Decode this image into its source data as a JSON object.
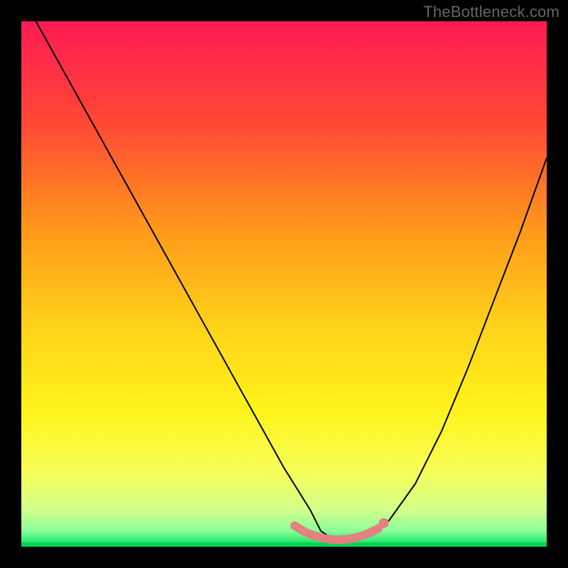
{
  "watermark": "TheBottleneck.com",
  "chart_data": {
    "type": "line",
    "title": "",
    "xlabel": "",
    "ylabel": "",
    "xlim": [
      0,
      100
    ],
    "ylim": [
      0,
      100
    ],
    "grid": false,
    "legend": false,
    "background_gradient": {
      "stops": [
        {
          "offset": 0.0,
          "color": "#ff1a53"
        },
        {
          "offset": 0.2,
          "color": "#ff4a33"
        },
        {
          "offset": 0.4,
          "color": "#ff9a1a"
        },
        {
          "offset": 0.58,
          "color": "#ffd21a"
        },
        {
          "offset": 0.74,
          "color": "#fff31a"
        },
        {
          "offset": 0.86,
          "color": "#f5ff5a"
        },
        {
          "offset": 0.93,
          "color": "#d2ff8a"
        },
        {
          "offset": 0.97,
          "color": "#8aff9a"
        },
        {
          "offset": 1.0,
          "color": "#00e05a"
        }
      ]
    },
    "series": [
      {
        "name": "bottleneck-curve",
        "color": "#000000",
        "x": [
          0,
          5,
          10,
          15,
          20,
          25,
          30,
          35,
          40,
          45,
          50,
          55,
          57,
          60,
          63,
          66,
          70,
          75,
          80,
          85,
          90,
          95,
          100
        ],
        "y": [
          105,
          96,
          87,
          78,
          69,
          60,
          51,
          42,
          33,
          24,
          15,
          7,
          3,
          1,
          1,
          2,
          5,
          12,
          22,
          34,
          47,
          60,
          74
        ]
      }
    ],
    "markers": {
      "name": "highlight-band",
      "color": "#e58080",
      "points": [
        {
          "x": 52,
          "y": 4.0
        },
        {
          "x": 54,
          "y": 2.8
        },
        {
          "x": 56,
          "y": 2.0
        },
        {
          "x": 58,
          "y": 1.5
        },
        {
          "x": 60,
          "y": 1.3
        },
        {
          "x": 62,
          "y": 1.4
        },
        {
          "x": 64,
          "y": 1.8
        },
        {
          "x": 66,
          "y": 2.5
        },
        {
          "x": 68,
          "y": 3.5
        }
      ],
      "end_dot": {
        "x": 69,
        "y": 4.5
      }
    }
  }
}
